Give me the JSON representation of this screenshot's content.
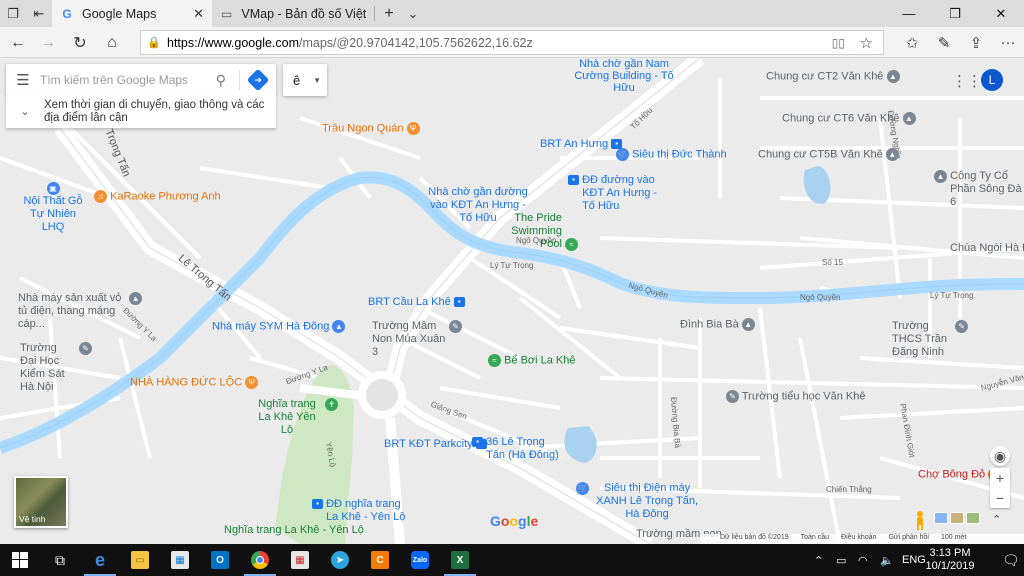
{
  "browser": {
    "tabs": [
      {
        "label": "Google Maps",
        "favicon": "G"
      },
      {
        "label": "VMap - Bản đồ số Việt Nam",
        "favicon": "▭"
      }
    ],
    "new_tab": "+",
    "tab_list": "⌄",
    "url_host": "https://www.google.com",
    "url_path": "/maps/@20.9704142,105.7562622,16.62z"
  },
  "search": {
    "placeholder": "Tìm kiếm trên Google Maps",
    "hint": "Xem thời gian di chuyển, giao thông và các địa điểm lân cận",
    "language": "ê",
    "avatar": "L"
  },
  "map": {
    "pois": [
      {
        "name": "Nhà chờ gần Nam Cường Building - Tố Hữu",
        "type": "bus"
      },
      {
        "name": "Chung cư CT2 Văn Khê",
        "type": "grey"
      },
      {
        "name": "Chung cư CT6 Văn Khê",
        "type": "grey"
      },
      {
        "name": "Chung cư CT5B Văn Khê",
        "type": "grey"
      },
      {
        "name": "Công Ty Cổ Phần Sông Đà 6",
        "type": "grey"
      },
      {
        "name": "Chùa Ngòi Hà Đông",
        "type": "grey"
      },
      {
        "name": "Trâu Ngon Quán",
        "type": "orange"
      },
      {
        "name": "BRT An Hưng",
        "type": "bus"
      },
      {
        "name": "Siêu thị Đức Thành",
        "type": "blue"
      },
      {
        "name": "ĐĐ đường vào KĐT An Hưng - Tố Hữu",
        "type": "bus"
      },
      {
        "name": "Nhà chờ gần đường vào KĐT An Hưng - Tố Hữu",
        "type": "bus"
      },
      {
        "name": "The Pride Swimming Pool",
        "type": "green"
      },
      {
        "name": "KaRaoke Phương Anh",
        "type": "orange"
      },
      {
        "name": "Nội Thất Gỗ Tự Nhiên LHQ",
        "type": "blue"
      },
      {
        "name": "Nhà máy sản xuất vỏ tủ điện, thang máng cáp...",
        "type": "grey"
      },
      {
        "name": "BRT Cầu La Khê",
        "type": "bus"
      },
      {
        "name": "Nhà máy SYM Hà Đông",
        "type": "blue"
      },
      {
        "name": "Trường Mầm Non Múa Xuân 3",
        "type": "grey"
      },
      {
        "name": "Bể Bơi La Khê",
        "type": "green"
      },
      {
        "name": "Đình Bia Bà",
        "type": "grey"
      },
      {
        "name": "Trường THCS Trần Đăng Ninh",
        "type": "grey"
      },
      {
        "name": "Trường Đại Học Kiểm Sát Hà Nội",
        "type": "grey"
      },
      {
        "name": "NHÀ HÀNG ĐỨC LỘC",
        "type": "orange"
      },
      {
        "name": "Nghĩa trang La Khê Yên Lộ",
        "type": "green"
      },
      {
        "name": "Trường tiểu học Văn Khê",
        "type": "grey"
      },
      {
        "name": "BRT KĐT Parkcity",
        "type": "bus"
      },
      {
        "name": "36 Lê Trọng Tấn (Hà Đông)",
        "type": "bus"
      },
      {
        "name": "Siêu thị Điện máy XANH Lê Trọng Tấn, Hà Đông",
        "type": "blue"
      },
      {
        "name": "Chợ Bông Đỏ",
        "type": "red"
      },
      {
        "name": "ĐĐ nghĩa trang La Khê - Yên Lộ",
        "type": "bus"
      },
      {
        "name": "Nghĩa trang La Khê - Yên Lộ",
        "type": "green"
      },
      {
        "name": "Trường mầm non",
        "type": "grey"
      }
    ],
    "streets": [
      "Lê Trọng Tấn",
      "Lê Trọng Tấn",
      "Tố Hữu",
      "Ngô Quyền",
      "Lý Tự Trọng",
      "Ngô Quyền",
      "Ngô Quyền",
      "Lý Tự Trọng",
      "Số 15",
      "Đường Y La",
      "Đường Y La",
      "Yên Lộ",
      "Giảng Sen",
      "Đường Bia Bà",
      "Đường Nghĩa",
      "Nguyễn Văn Khê",
      "Phan Đình Giót",
      "Chiến Thắng"
    ],
    "satellite_label": "Vệ tinh",
    "google_logo": "Google",
    "attribution": [
      "Dữ liệu bản đồ ©2019",
      "Toàn cầu",
      "Điều khoản",
      "Gửi phản hồi",
      "100 mét"
    ],
    "zoom_in": "+",
    "zoom_out": "−"
  },
  "taskbar": {
    "language": "ENG",
    "time": "3:13 PM",
    "date": "10/1/2019",
    "apps": [
      {
        "name": "task-view",
        "color": "#101010",
        "glyph": "⧉"
      },
      {
        "name": "edge",
        "color": "#1e88e5",
        "glyph": "e"
      },
      {
        "name": "file-explorer",
        "color": "#f6c343",
        "glyph": "▭"
      },
      {
        "name": "store",
        "color": "#f3f3f3",
        "glyph": "🛍"
      },
      {
        "name": "outlook",
        "color": "#0072c6",
        "glyph": "O"
      },
      {
        "name": "chrome",
        "color": "#e0e0e0",
        "glyph": "◎"
      },
      {
        "name": "app-grid",
        "color": "#c62828",
        "glyph": "▦"
      },
      {
        "name": "telegram",
        "color": "#2ca5e0",
        "glyph": "➤"
      },
      {
        "name": "coccoc",
        "color": "#f57c00",
        "glyph": "C"
      },
      {
        "name": "zalo",
        "color": "#0068ff",
        "glyph": "Zalo"
      },
      {
        "name": "excel",
        "color": "#1d6f42",
        "glyph": "X"
      }
    ]
  }
}
